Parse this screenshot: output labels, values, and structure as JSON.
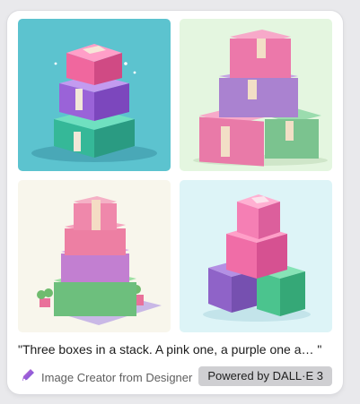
{
  "card": {
    "images": [
      {
        "alt": "stack-1",
        "bg": "#5cc3cf"
      },
      {
        "alt": "stack-2",
        "bg": "#e4f6e0"
      },
      {
        "alt": "stack-3",
        "bg": "#f8f6ec"
      },
      {
        "alt": "stack-4",
        "bg": "#ddf4f7"
      }
    ],
    "prompt": "\"Three boxes in a stack. A pink one, a purple one a… \"",
    "creator_label": "Image Creator from Designer",
    "powered_by": "Powered by DALL·E 3",
    "creator_icon": "designer-pen-icon"
  },
  "colors": {
    "pink": "#ef6fa6",
    "purple": "#a673d6",
    "green": "#3fc8a2",
    "tape": "#f4dcc4"
  }
}
